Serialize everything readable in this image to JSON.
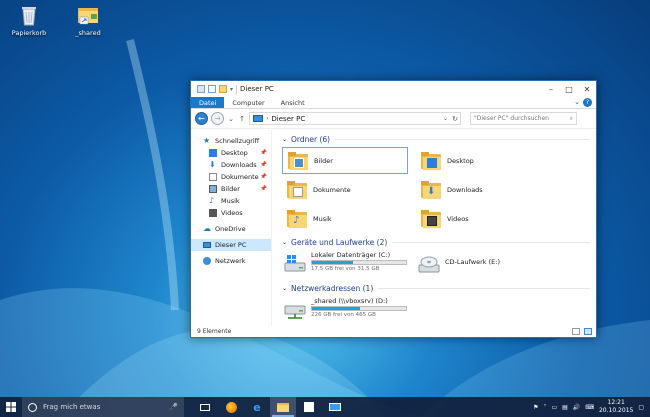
{
  "desktop": {
    "icons": [
      {
        "name": "recycle-bin",
        "label": "Papierkorb"
      },
      {
        "name": "shared-shortcut",
        "label": "_shared"
      }
    ]
  },
  "window": {
    "title": "Dieser PC",
    "ribbon_tabs": [
      "Datei",
      "Computer",
      "Ansicht"
    ],
    "address": {
      "location": "Dieser PC",
      "search_placeholder": "\"Dieser PC\" durchsuchen"
    },
    "nav_pane": {
      "quick_access": "Schnellzugriff",
      "quick_items": [
        "Desktop",
        "Downloads",
        "Dokumente",
        "Bilder",
        "Musik",
        "Videos"
      ],
      "onedrive": "OneDrive",
      "this_pc": "Dieser PC",
      "network": "Netzwerk"
    },
    "groups": {
      "folders": {
        "header": "Ordner (6)",
        "items": [
          "Bilder",
          "Desktop",
          "Dokumente",
          "Downloads",
          "Musik",
          "Videos"
        ]
      },
      "devices": {
        "header": "Geräte und Laufwerke (2)",
        "drive_c": {
          "name": "Lokaler Datenträger (C:)",
          "free": "17,5 GB frei von 31,5 GB",
          "used_fraction": 0.44
        },
        "drive_e": {
          "name": "CD-Laufwerk (E:)"
        }
      },
      "network": {
        "header": "Netzwerkadressen (1)",
        "drive_d": {
          "name": "_shared (\\\\vboxsrv) (D:)",
          "free": "226 GB frei von 465 GB",
          "used_fraction": 0.51
        }
      }
    },
    "status": "9 Elemente"
  },
  "taskbar": {
    "search_placeholder": "Frag mich etwas",
    "time": "12:21",
    "date": "20.10.2015"
  },
  "colors": {
    "accent": "#1979ca",
    "folder": "#f8d675",
    "capacity": "#26a0da"
  }
}
